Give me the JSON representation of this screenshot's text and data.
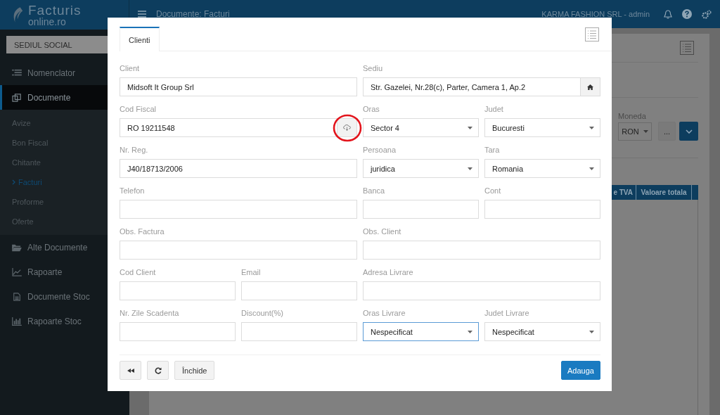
{
  "logo": {
    "line1": "Facturis",
    "line2": "online.ro"
  },
  "header": {
    "title": "Documente: Facturi",
    "account": "KARMA FASHION SRL - admin"
  },
  "sidebar": {
    "company": "SEDIUL SOCIAL",
    "items": [
      {
        "label": "Nomenclator",
        "selected": false
      },
      {
        "label": "Documente",
        "selected": true,
        "expanded": true,
        "children": [
          {
            "label": "Avize",
            "selected": false
          },
          {
            "label": "Bon Fiscal",
            "selected": false
          },
          {
            "label": "Chitante",
            "selected": false
          },
          {
            "label": "Facturi",
            "selected": true
          },
          {
            "label": "Proforme",
            "selected": false
          },
          {
            "label": "Oferte",
            "selected": false
          }
        ]
      },
      {
        "label": "Alte Documente",
        "selected": false
      },
      {
        "label": "Rapoarte",
        "selected": false
      },
      {
        "label": "Documente Stoc",
        "selected": false
      },
      {
        "label": "Rapoarte Stoc",
        "selected": false
      }
    ]
  },
  "background": {
    "currency_label": "Moneda",
    "currency": "RON",
    "more_button": "...",
    "table_columns": [
      "e TVA",
      "Valoare totala"
    ]
  },
  "modal": {
    "tabs": [
      {
        "label": "Clienti",
        "selected": true
      }
    ],
    "fields": [
      {
        "kind": "input",
        "wide": true,
        "label": "Client",
        "value": "Midsoft It Group Srl",
        "focused": false,
        "highlighted": false
      },
      {
        "kind": "input-home",
        "wide": true,
        "label": "Sediu",
        "value": "Str. Gazelei, Nr.28(c), Parter, Camera 1, Ap.2",
        "focused": false,
        "highlighted": false
      },
      {
        "kind": "input-cloud",
        "wide": true,
        "label": "Cod Fiscal",
        "value": "RO 19211548",
        "focused": false,
        "highlighted": true
      },
      {
        "kind": "select",
        "wide": false,
        "label": "Oras",
        "value": "Sector 4",
        "focused": false,
        "highlighted": false
      },
      {
        "kind": "select",
        "wide": false,
        "label": "Judet",
        "value": "Bucuresti",
        "focused": false,
        "highlighted": false
      },
      {
        "kind": "input",
        "wide": true,
        "label": "Nr. Reg.",
        "value": "J40/18713/2006",
        "focused": false,
        "highlighted": false
      },
      {
        "kind": "select",
        "wide": false,
        "label": "Persoana",
        "value": "juridica",
        "focused": false,
        "highlighted": false
      },
      {
        "kind": "select",
        "wide": false,
        "label": "Tara",
        "value": "Romania",
        "focused": false,
        "highlighted": false
      },
      {
        "kind": "input",
        "wide": true,
        "label": "Telefon",
        "focused": false,
        "highlighted": false
      },
      {
        "kind": "input",
        "wide": false,
        "label": "Banca",
        "focused": false,
        "highlighted": false
      },
      {
        "kind": "input",
        "wide": false,
        "label": "Cont",
        "focused": false,
        "highlighted": false
      },
      {
        "kind": "input",
        "wide": true,
        "label": "Obs. Factura",
        "focused": false,
        "highlighted": false
      },
      {
        "kind": "input",
        "wide": true,
        "label": "Obs. Client",
        "focused": false,
        "highlighted": false
      },
      {
        "kind": "input",
        "wide": false,
        "label": "Cod Client",
        "focused": false,
        "highlighted": false
      },
      {
        "kind": "input",
        "wide": false,
        "label": "Email",
        "focused": false,
        "highlighted": false
      },
      {
        "kind": "input",
        "wide": true,
        "label": "Adresa Livrare",
        "focused": false,
        "highlighted": false
      },
      {
        "kind": "input",
        "wide": false,
        "label": "Nr. Zile Scadenta",
        "focused": false,
        "highlighted": false
      },
      {
        "kind": "input",
        "wide": false,
        "label": "Discount(%)",
        "focused": false,
        "highlighted": false
      },
      {
        "kind": "select",
        "wide": false,
        "label": "Oras Livrare",
        "value": "Nespecificat",
        "focused": true,
        "highlighted": false
      },
      {
        "kind": "select",
        "wide": false,
        "label": "Judet Livrare",
        "value": "Nespecificat",
        "focused": false,
        "highlighted": false
      }
    ],
    "buttons": [
      {
        "kind": "rewind"
      },
      {
        "kind": "refresh"
      },
      {
        "kind": "text",
        "label": "Închide"
      },
      {
        "kind": "primary",
        "label": "Adauga"
      }
    ]
  }
}
